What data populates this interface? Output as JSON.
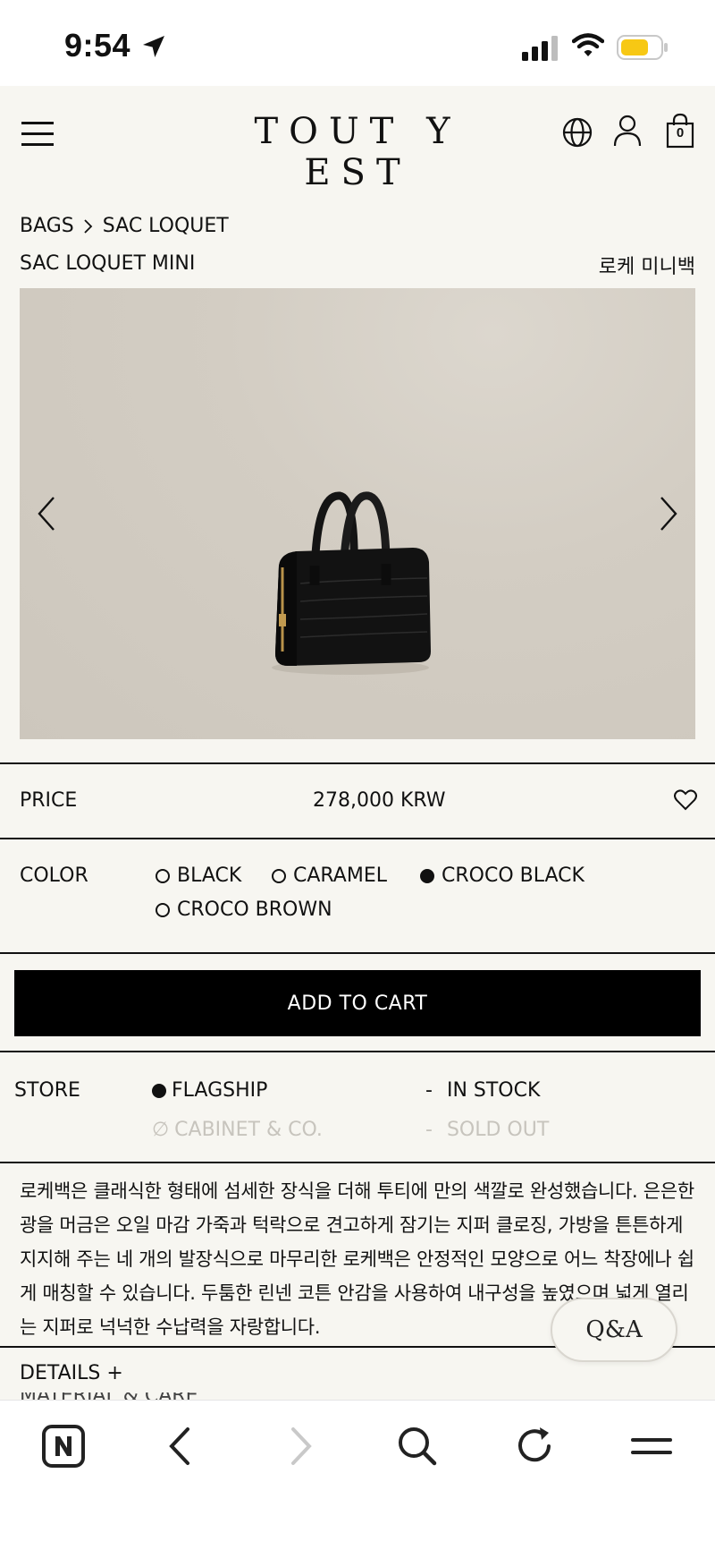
{
  "status_bar": {
    "time": "9:54"
  },
  "header": {
    "brand": "TOUT Y EST",
    "cart_count": "0"
  },
  "breadcrumb": {
    "parent": "BAGS",
    "current": "SAC LOQUET"
  },
  "product": {
    "name": "SAC LOQUET MINI",
    "name_ko": "로케 미니백",
    "price_label": "PRICE",
    "price": "278,000 KRW"
  },
  "color": {
    "label": "COLOR",
    "options": [
      {
        "name": "BLACK",
        "selected": false
      },
      {
        "name": "CARAMEL",
        "selected": false
      },
      {
        "name": "CROCO BLACK",
        "selected": true
      },
      {
        "name": "CROCO BROWN",
        "selected": false
      }
    ]
  },
  "cart": {
    "button_label": "ADD TO CART"
  },
  "store": {
    "label": "STORE",
    "rows": [
      {
        "name": "FLAGSHIP",
        "status": "IN STOCK",
        "available": true
      },
      {
        "name": "CABINET & CO.",
        "status": "SOLD OUT",
        "available": false
      }
    ]
  },
  "description": "로케백은 클래식한 형태에 섬세한 장식을 더해 투티에 만의 색깔로 완성했습니다. 은은한 광을 머금은 오일 마감 가죽과 턱락으로 견고하게 잠기는 지퍼 클로징, 가방을 튼튼하게 지지해 주는 네 개의 발장식으로 마무리한 로케백은 안정적인 모양으로 어느 착장에나 쉽게 매칭할 수 있습니다. 두툼한 린넨 코튼 안감을 사용하여 내구성을 높였으며 넓게 열리는 지퍼로 넉넉한 수납력을 자랑합니다.",
  "qa": {
    "label": "Q&A"
  },
  "details": {
    "label": "DETAILS +",
    "next_label": "MATERIAL & CARE"
  },
  "colors": {
    "background": "#f7f6f1",
    "button": "#000000",
    "muted": "#c7c4bd"
  }
}
